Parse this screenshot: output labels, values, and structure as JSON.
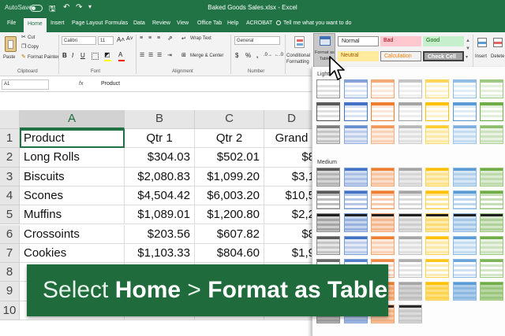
{
  "titlebar": {
    "autosave": "AutoSave",
    "title": "Baked Goods Sales.xlsx  -  Excel"
  },
  "tabs": [
    "File",
    "Home",
    "Insert",
    "Page Layout",
    "Formulas",
    "Data",
    "Review",
    "View",
    "Office Tab",
    "Help",
    "ACROBAT"
  ],
  "active_tab": "Home",
  "tell_me": "Tell me what you want to do",
  "ribbon": {
    "clipboard": {
      "paste": "Paste",
      "cut": "Cut",
      "copy": "Copy",
      "format_painter": "Format Painter",
      "label": "Clipboard"
    },
    "font": {
      "name": "Calibri",
      "size": "11",
      "bold": "B",
      "italic": "I",
      "underline": "U",
      "label": "Font"
    },
    "alignment": {
      "wrap_text": "Wrap Text",
      "merge_center": "Merge & Center",
      "label": "Alignment"
    },
    "number": {
      "format": "General",
      "currency": "$",
      "percent": "%",
      "comma": ",",
      "label": "Number"
    },
    "conditional": {
      "line1": "Conditional",
      "line2": "Formatting"
    },
    "format_as_table": {
      "line1": "Format as",
      "line2": "Table"
    },
    "cell_styles": [
      {
        "label": "Normal",
        "bg": "#ffffff",
        "fg": "#222222"
      },
      {
        "label": "Bad",
        "bg": "#ffc7ce",
        "fg": "#9c0006"
      },
      {
        "label": "Good",
        "bg": "#c6efce",
        "fg": "#006100"
      },
      {
        "label": "Neutral",
        "bg": "#ffeb9c",
        "fg": "#9c5700"
      },
      {
        "label": "Calculation",
        "bg": "#f2f2f2",
        "fg": "#fa7d00"
      },
      {
        "label": "Check Cell",
        "bg": "#a5a5a5",
        "fg": "#ffffff"
      }
    ],
    "insert": "Insert",
    "delete": "Delete"
  },
  "formula_bar": {
    "name_box": "A1",
    "fx": "fx",
    "value": "Product"
  },
  "grid": {
    "columns": [
      "A",
      "B",
      "C",
      "D"
    ],
    "rows": [
      "1",
      "2",
      "3",
      "4",
      "5",
      "6",
      "7",
      "8",
      "9",
      "10"
    ],
    "data": [
      [
        "Product",
        "Qtr 1",
        "Qtr 2",
        "Grand"
      ],
      [
        "Long Rolls",
        "$304.03",
        "$502.01",
        "$8"
      ],
      [
        "Biscuits",
        "$2,080.83",
        "$1,099.20",
        "$3,1"
      ],
      [
        "Scones",
        "$4,504.42",
        "$6,003.20",
        "$10,5"
      ],
      [
        "Muffins",
        "$1,089.01",
        "$1,200.80",
        "$2,2"
      ],
      [
        "Crossoints",
        "$203.56",
        "$607.82",
        "$8"
      ],
      [
        "Cookies",
        "$1,103.33",
        "$804.60",
        "$1,9"
      ]
    ]
  },
  "gallery": {
    "light_label": "Light",
    "medium_label": "Medium",
    "palette": [
      "#5a5a5a",
      "#4472c4",
      "#ed7d31",
      "#a5a5a5",
      "#ffc000",
      "#5b9bd5",
      "#70ad47"
    ]
  },
  "banner": {
    "prefix": "Select ",
    "home": "Home",
    "sep": " > ",
    "target": "Format as Table"
  },
  "colors": {
    "excel_green": "#217346",
    "banner_green": "#1f6b3c"
  }
}
